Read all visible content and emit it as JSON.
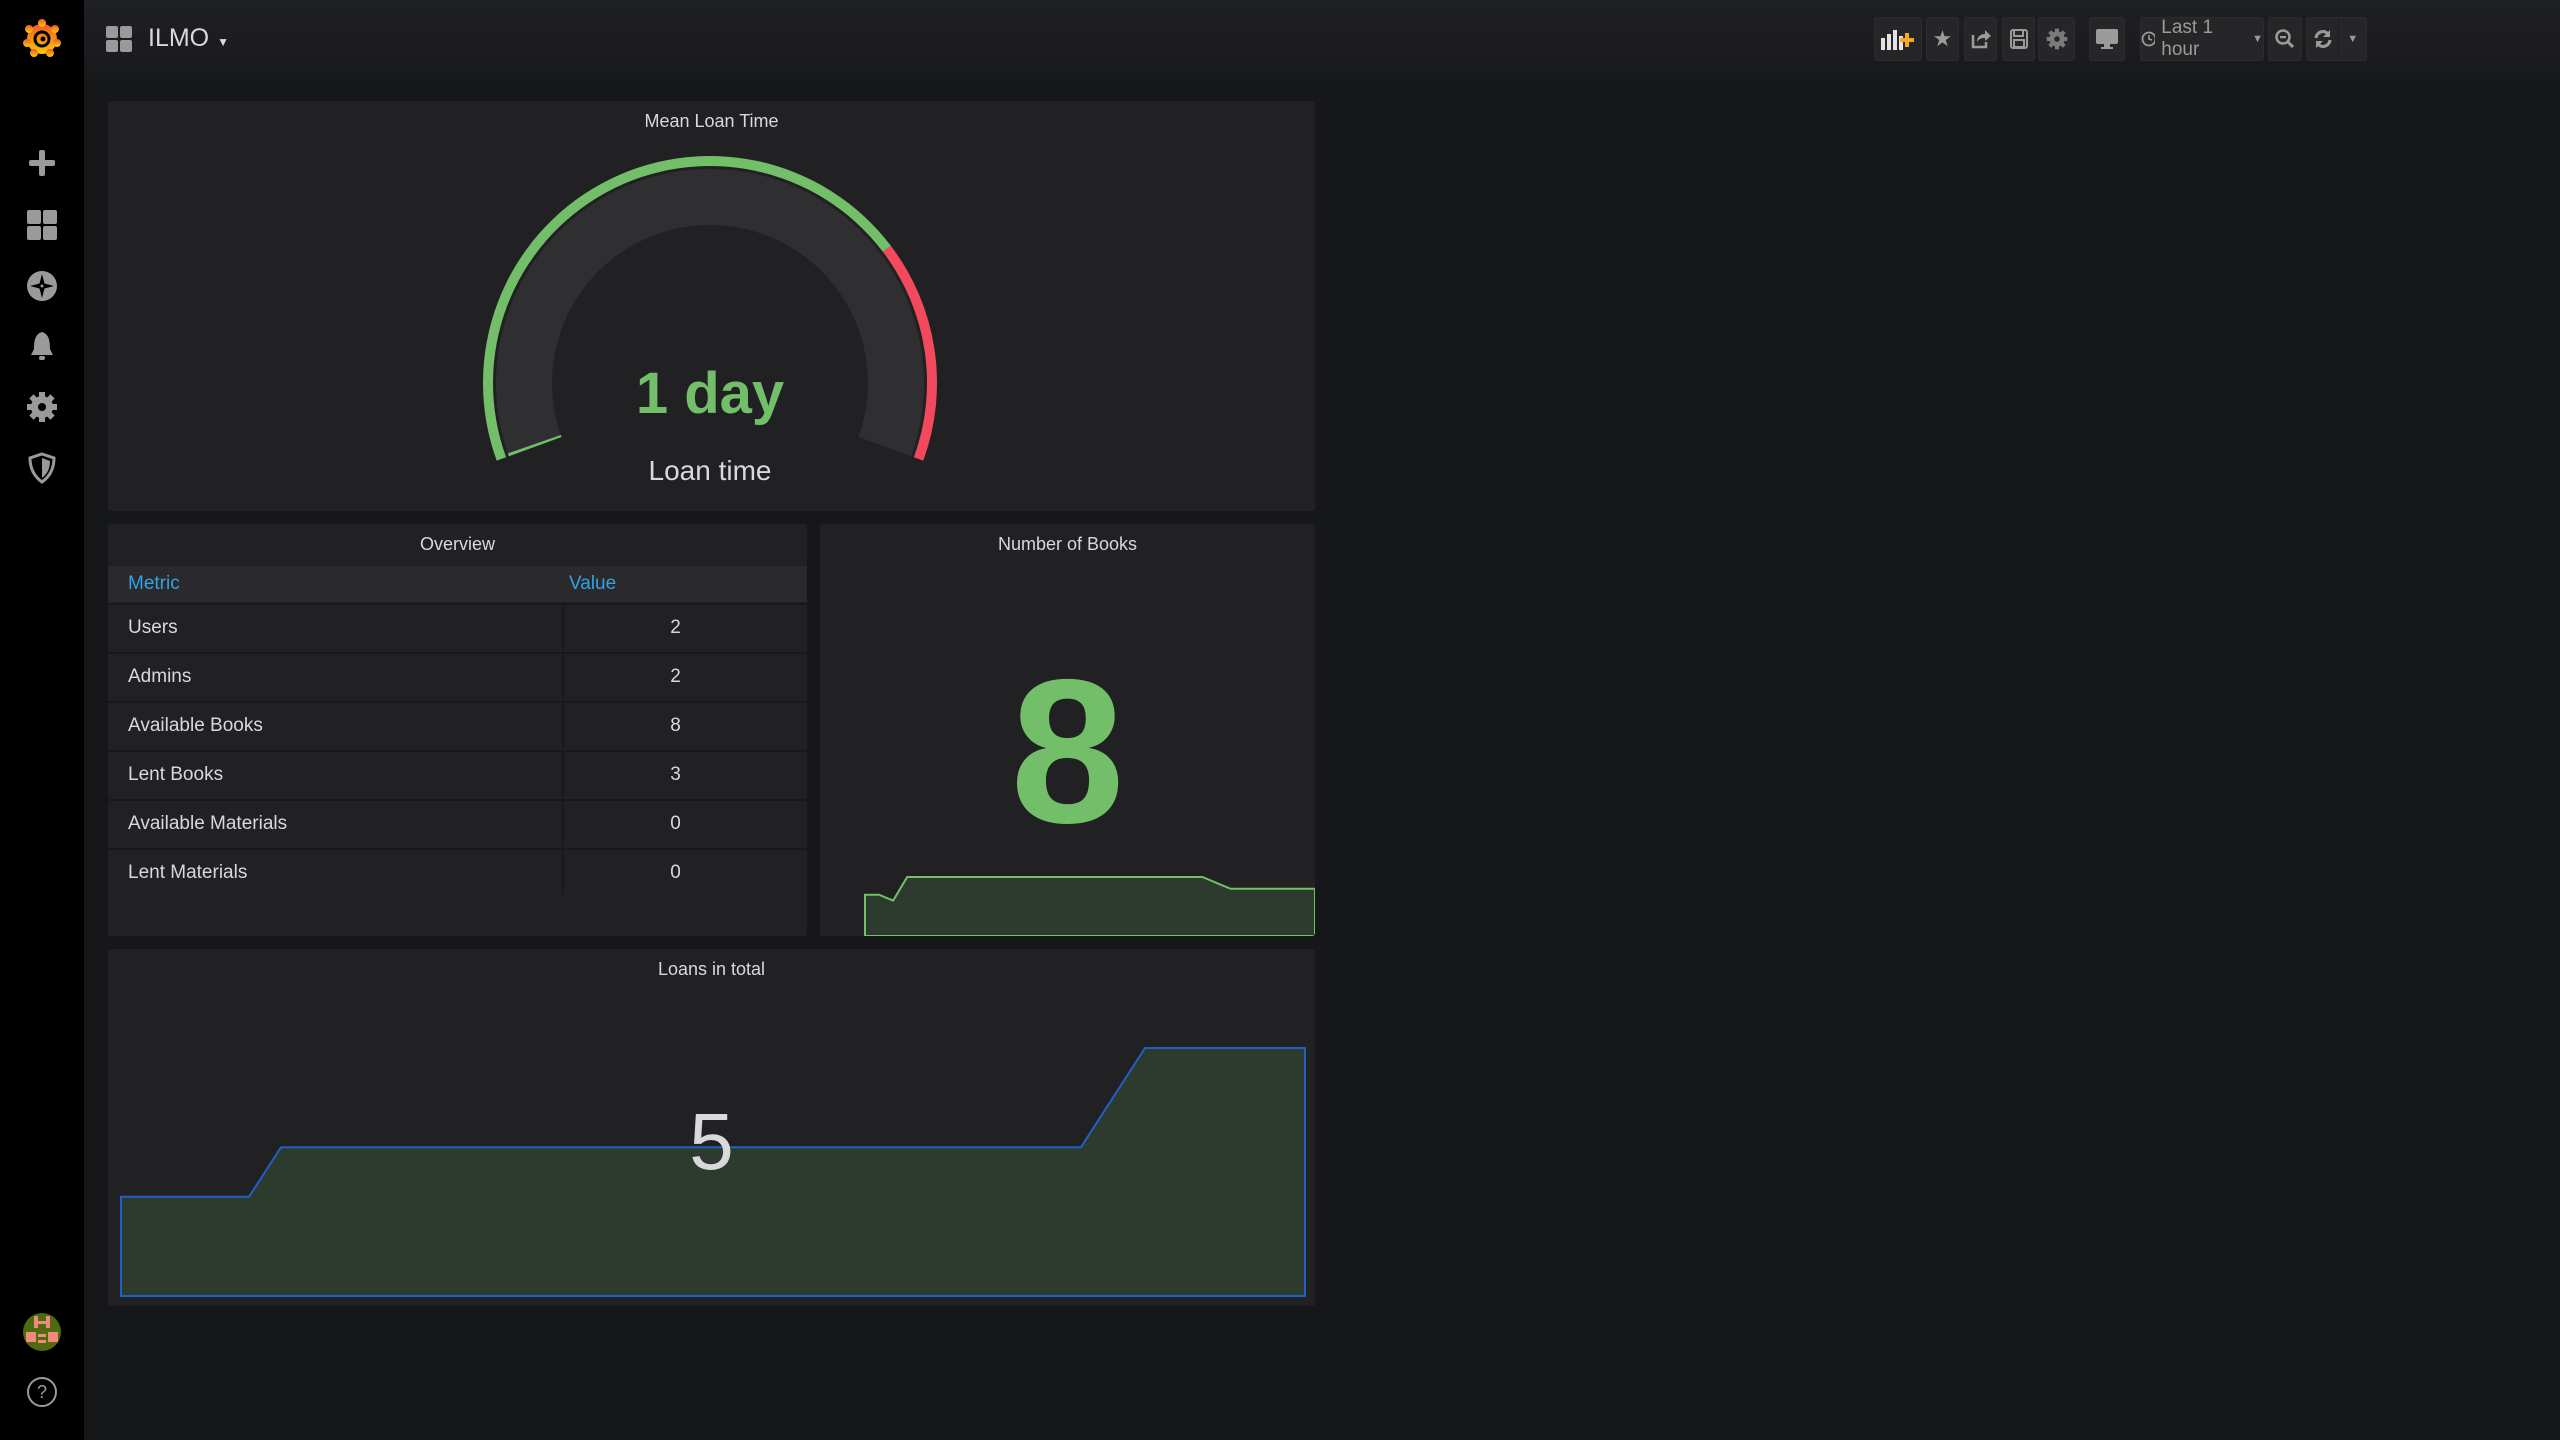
{
  "app": {
    "dashboard_title": "ILMO",
    "logo": "grafana-logo"
  },
  "sidebar": {
    "items": [
      {
        "icon": "plus-icon",
        "label": "Create"
      },
      {
        "icon": "dashboards-icon",
        "label": "Dashboards"
      },
      {
        "icon": "compass-icon",
        "label": "Explore"
      },
      {
        "icon": "bell-icon",
        "label": "Alerting"
      },
      {
        "icon": "gear-icon",
        "label": "Configuration"
      },
      {
        "icon": "shield-icon",
        "label": "Server Admin"
      }
    ],
    "bottom": [
      {
        "icon": "avatar"
      },
      {
        "icon": "help-icon"
      }
    ]
  },
  "toolbar": {
    "time_range": "Last 1 hour"
  },
  "colors": {
    "green": "#73bf69",
    "red": "#f2495c",
    "blue_header": "#33a2e5",
    "fill": "#2d3b2f",
    "loans_line": "#1f60c4"
  },
  "gauge": {
    "title": "Mean Loan Time",
    "value": "1 day",
    "label": "Loan time",
    "fill_fraction": 0.0,
    "threshold_red_from_fraction": 0.74
  },
  "overview": {
    "title": "Overview",
    "columns": [
      "Metric",
      "Value"
    ],
    "rows": [
      {
        "metric": "Users",
        "value": "2"
      },
      {
        "metric": "Admins",
        "value": "2"
      },
      {
        "metric": "Available Books",
        "value": "8"
      },
      {
        "metric": "Lent Books",
        "value": "3"
      },
      {
        "metric": "Available Materials",
        "value": "0"
      },
      {
        "metric": "Lent Materials",
        "value": "0"
      }
    ]
  },
  "books": {
    "title": "Number of Books",
    "value": "8"
  },
  "loans": {
    "title": "Loans in total",
    "value": "5"
  },
  "chart_data": [
    {
      "type": "area",
      "name": "Number of Books sparkline",
      "values": [
        7,
        7,
        6,
        10,
        10,
        10,
        10,
        10,
        10,
        10,
        10,
        10,
        10,
        10,
        10,
        10,
        10,
        10,
        10,
        10,
        10,
        10,
        10,
        10,
        10,
        9,
        8,
        8,
        8,
        8,
        8,
        8,
        8
      ]
    },
    {
      "type": "area",
      "name": "Loans in total sparkline",
      "values": [
        2,
        2,
        2,
        2,
        2,
        3,
        3,
        3,
        3,
        3,
        3,
        3,
        3,
        3,
        3,
        3,
        3,
        3,
        3,
        3,
        3,
        3,
        3,
        3,
        3,
        3,
        3,
        3,
        3,
        3,
        3,
        4,
        5,
        5,
        5,
        5,
        5,
        5
      ]
    }
  ]
}
